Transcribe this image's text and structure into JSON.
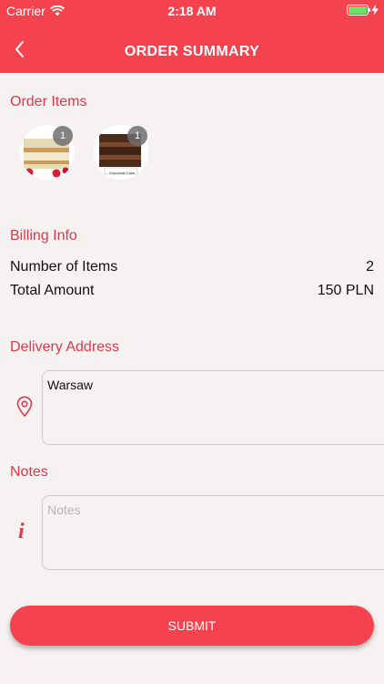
{
  "status_bar": {
    "carrier": "Carrier",
    "time": "2:18 AM"
  },
  "header": {
    "title": "ORDER SUMMARY",
    "back_icon": "chevron-left-icon"
  },
  "order_items": {
    "title": "Order Items",
    "items": [
      {
        "image": "vanilla-cake-slice",
        "quantity": "1"
      },
      {
        "image": "chocolate-cake-slice",
        "quantity": "1",
        "caption": "Chocolate Cake"
      }
    ]
  },
  "billing": {
    "title": "Billing Info",
    "rows": [
      {
        "label": "Number of Items",
        "value": "2"
      },
      {
        "label": "Total Amount",
        "value": "150 PLN"
      }
    ]
  },
  "delivery": {
    "title": "Delivery Address",
    "icon": "map-pin-icon",
    "value": "Warsaw"
  },
  "notes": {
    "title": "Notes",
    "icon": "info-icon",
    "value": "",
    "placeholder": "Notes"
  },
  "submit": {
    "label": "SUBMIT"
  },
  "colors": {
    "accent": "#f4434f",
    "title_text": "#e0374a",
    "background": "#f7f2f2"
  }
}
